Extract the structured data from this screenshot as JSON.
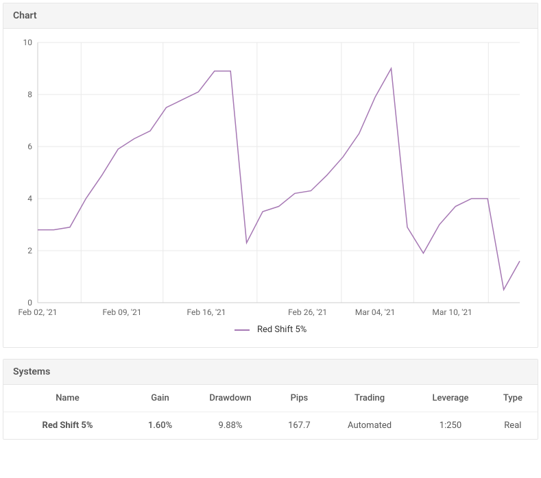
{
  "chart_panel": {
    "title": "Chart"
  },
  "legend": {
    "label": "Red Shift 5%",
    "color": "#a678b4"
  },
  "chart_data": {
    "type": "line",
    "title": "",
    "xlabel": "",
    "ylabel": "",
    "ylim": [
      0,
      10
    ],
    "y_ticks": [
      0,
      2,
      4,
      6,
      8,
      10
    ],
    "x_tick_labels": [
      "Feb 02, '21",
      "Feb 09, '21",
      "Feb 16, '21",
      "Feb 26, '21",
      "Mar 04, '21",
      "Mar 10, '21"
    ],
    "series": [
      {
        "name": "Red Shift 5%",
        "color": "#a678b4",
        "x": [
          "Feb 02",
          "Feb 03",
          "Feb 04",
          "Feb 05",
          "Feb 08",
          "Feb 09",
          "Feb 10",
          "Feb 11",
          "Feb 12",
          "Feb 15",
          "Feb 16",
          "Feb 17",
          "Feb 18",
          "Feb 19",
          "Feb 22",
          "Feb 23",
          "Feb 24",
          "Feb 25",
          "Feb 26",
          "Mar 01",
          "Mar 02",
          "Mar 03",
          "Mar 04",
          "Mar 05",
          "Mar 08",
          "Mar 09",
          "Mar 10",
          "Mar 11",
          "Mar 12",
          "Mar 15",
          "Mar 16"
        ],
        "values": [
          2.8,
          2.8,
          2.9,
          4.0,
          4.9,
          5.9,
          6.3,
          6.6,
          7.5,
          7.8,
          8.1,
          8.9,
          8.9,
          2.3,
          3.5,
          3.7,
          4.2,
          4.3,
          4.9,
          5.6,
          6.5,
          7.9,
          9.0,
          2.9,
          1.9,
          3.0,
          3.7,
          4.0,
          4.0,
          0.5,
          1.6
        ]
      }
    ]
  },
  "systems_panel": {
    "title": "Systems",
    "columns": [
      "Name",
      "Gain",
      "Drawdown",
      "Pips",
      "Trading",
      "Leverage",
      "Type"
    ],
    "rows": [
      {
        "name": "Red Shift 5%",
        "gain": "1.60%",
        "gain_positive": true,
        "drawdown": "9.88%",
        "pips": "167.7",
        "trading": "Automated",
        "leverage": "1:250",
        "type": "Real"
      }
    ]
  }
}
